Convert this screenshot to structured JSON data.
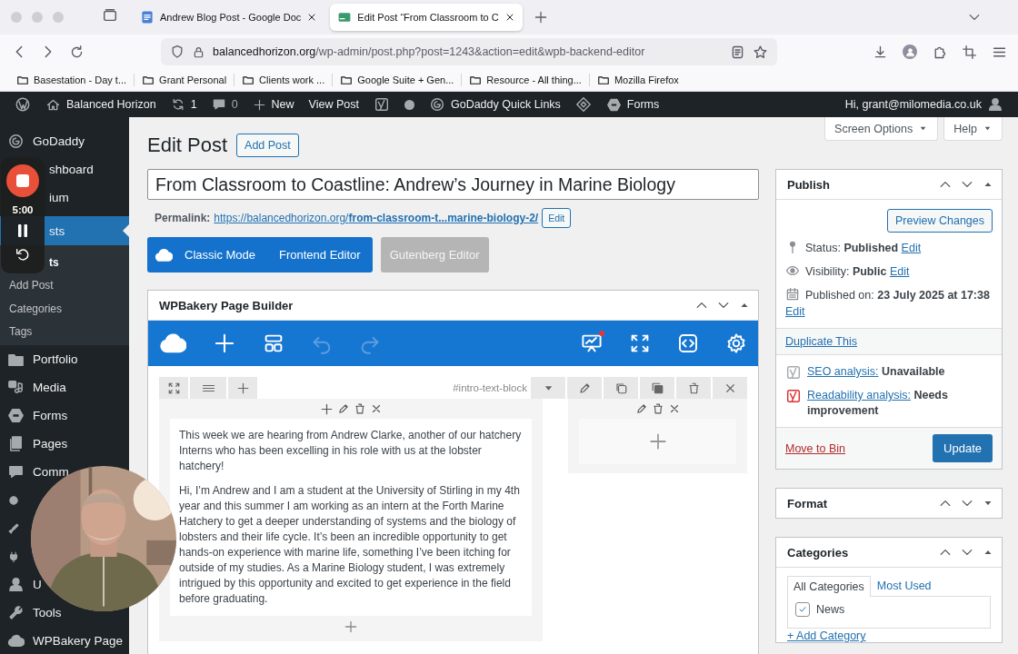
{
  "browser": {
    "tabs": [
      {
        "title": "Andrew Blog Post - Google Doc",
        "selected": false
      },
      {
        "title": "Edit Post “From Classroom to C",
        "selected": true
      }
    ],
    "url_host": "balancedhorizon.org",
    "url_path": "/wp-admin/post.php?post=1243&action=edit&wpb-backend-editor",
    "bookmarks": [
      "Basestation - Day t...",
      "Grant Personal",
      "Clients work ...",
      "Google Suite + Gen...",
      "Resource - All thing...",
      "Mozilla Firefox"
    ]
  },
  "admin_bar": {
    "site": "Balanced Horizon",
    "updates": "1",
    "comments": "0",
    "new": "New",
    "view_post": "View Post",
    "quick_links": "GoDaddy Quick Links",
    "forms": "Forms",
    "account": "Hi, grant@milomedia.co.uk"
  },
  "sidebar": {
    "items": [
      {
        "label": "GoDaddy",
        "kind": "full",
        "selected": false
      },
      {
        "label": "shboard",
        "kind": "covered",
        "selected": false
      },
      {
        "label": "ium",
        "kind": "covered",
        "selected": false
      },
      {
        "label": "sts",
        "kind": "covered",
        "selected": true,
        "children": [
          {
            "label": "ts",
            "kind": "covered",
            "selected": true
          },
          {
            "label": "Add Post",
            "kind": "full",
            "selected": false
          },
          {
            "label": "Categories",
            "kind": "full",
            "selected": false
          },
          {
            "label": "Tags",
            "kind": "full",
            "selected": false
          }
        ]
      },
      {
        "label": "Portfolio",
        "kind": "full",
        "selected": false
      },
      {
        "label": "Media",
        "kind": "full",
        "selected": false
      },
      {
        "label": "Forms",
        "kind": "full",
        "selected": false
      },
      {
        "label": "Pages",
        "kind": "full",
        "selected": false
      },
      {
        "label": "Comm",
        "kind": "full",
        "selected": false
      },
      {
        "kind": "icon",
        "selected": false
      },
      {
        "kind": "icon",
        "selected": false
      },
      {
        "kind": "icon",
        "selected": false
      },
      {
        "label": "U",
        "kind": "full",
        "selected": false
      },
      {
        "label": "Tools",
        "kind": "full",
        "selected": false
      },
      {
        "label": "WPBakery Page",
        "kind": "full",
        "selected": false
      }
    ]
  },
  "recorder": {
    "timer": "5:00"
  },
  "header": {
    "screen_options": "Screen Options",
    "help": "Help"
  },
  "editor": {
    "heading": "Edit Post",
    "add_button": "Add Post",
    "post_title": "From Classroom to Coastline: Andrew’s Journey in Marine Biology",
    "permalink_label": "Permalink:",
    "permalink": "https://balancedhorizon.org/**from-classroom-t...marine-biology-2/**",
    "permalink_edit": "Edit",
    "modes": [
      {
        "label": "Classic Mode",
        "kind": "primary"
      },
      {
        "label": "Frontend Editor",
        "kind": "primary"
      },
      {
        "label": "Gutenberg Editor",
        "kind": "secondary"
      }
    ]
  },
  "page_builder": {
    "title": "WPBakery Page Builder",
    "expanded": true,
    "element_id": "#intro-text-block",
    "paragraphs": [
      "This week we are hearing from Andrew Clarke, another of our hatchery Interns who has been excelling in his role with us at the lobster hatchery!",
      "Hi, I’m Andrew and I am a student at the University of Stirling in my 4th year and this summer I am working as an intern at the Forth Marine Hatchery to get a deeper understanding of systems and the biology of lobsters and their life cycle. It’s been an incredible opportunity to get hands-on experience with marine life, something I’ve been itching for outside of my studies. As a Marine Biology student, I was extremely intrigued by this opportunity and excited to get experience in the field before graduating."
    ]
  },
  "publish": {
    "title": "Publish",
    "expanded": true,
    "preview": "Preview Changes",
    "rows": [
      {
        "text": "Status: **Published**",
        "link": "Edit"
      },
      {
        "text": "Visibility: **Public**",
        "link": "Edit"
      },
      {
        "text": "Published on: **23 July 2025 at 17:38**",
        "link": "Edit"
      }
    ],
    "duplicate": "Duplicate This",
    "analysis": [
      {
        "link": "SEO analysis:",
        "value": "Unavailable",
        "kind": "neutral"
      },
      {
        "link": "Readability analysis:",
        "value": "Needs improvement",
        "kind": "poor"
      }
    ],
    "trash": "Move to Bin",
    "update": "Update"
  },
  "format": {
    "title": "Format",
    "expanded": false
  },
  "categories": {
    "title": "Categories",
    "expanded": true,
    "tabs": [
      {
        "label": "All Categories",
        "selected": true
      },
      {
        "label": "Most Used",
        "selected": false
      }
    ],
    "items": [
      {
        "label": "News",
        "checked": true
      }
    ],
    "add_link": "+ Add Category"
  }
}
